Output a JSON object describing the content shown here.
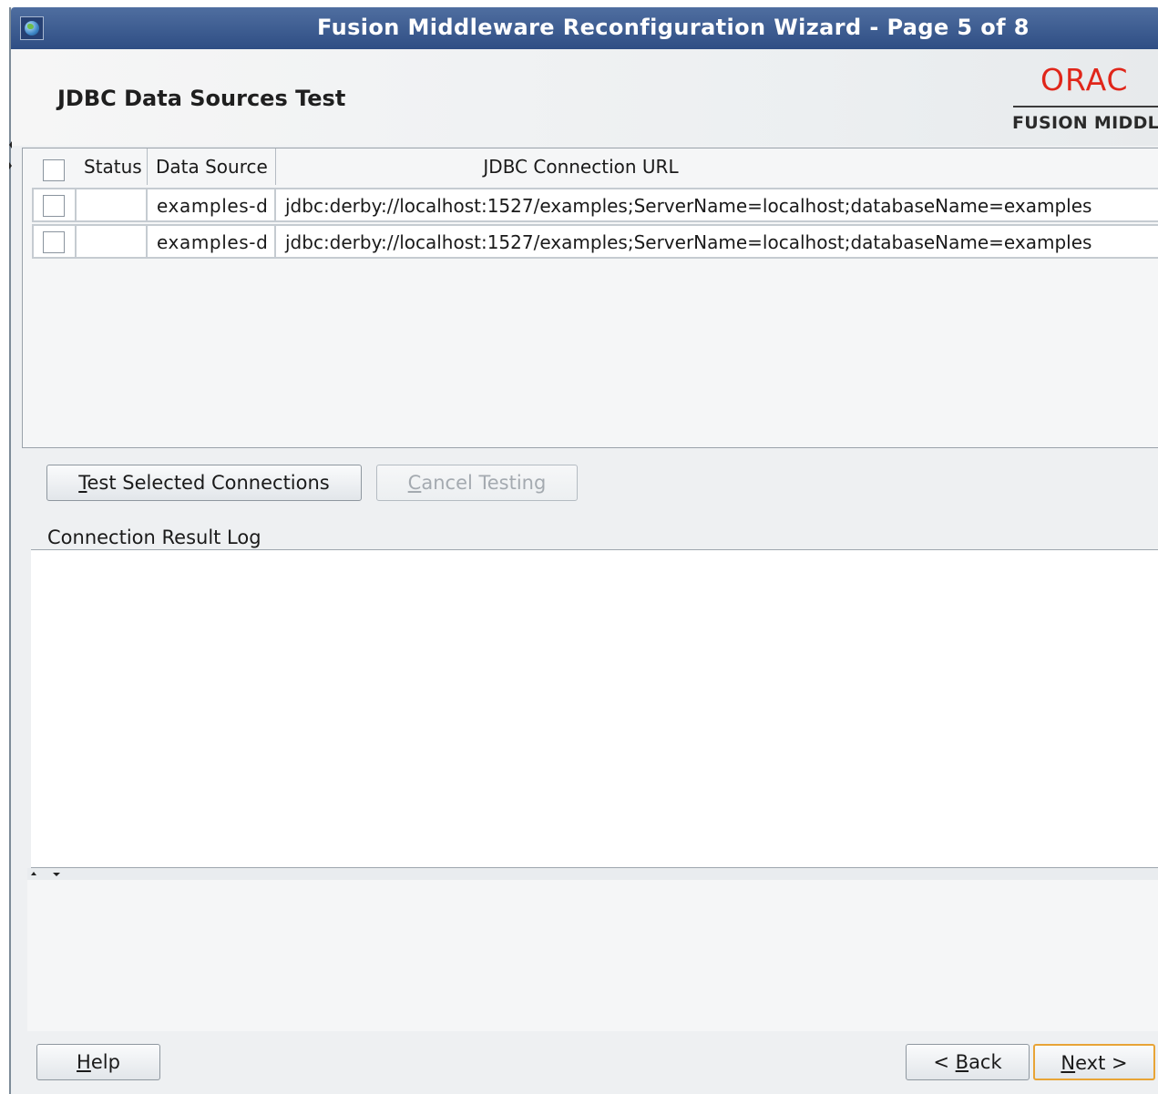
{
  "window": {
    "title": "Fusion Middleware Reconfiguration Wizard - Page 5 of 8"
  },
  "header": {
    "page_title": "JDBC Data Sources Test",
    "logo_text": "ORAC",
    "logo_subtext": "FUSION MIDDL"
  },
  "table": {
    "columns": [
      "Status",
      "Data Source",
      "JDBC Connection URL"
    ],
    "rows": [
      {
        "checked": false,
        "status": "",
        "data_source": "examples-d",
        "url": "jdbc:derby://localhost:1527/examples;ServerName=localhost;databaseName=examples"
      },
      {
        "checked": false,
        "status": "",
        "data_source": "examples-d",
        "url": "jdbc:derby://localhost:1527/examples;ServerName=localhost;databaseName=examples"
      }
    ]
  },
  "actions": {
    "test_label_mnemonic": "T",
    "test_label_rest": "est Selected Connections",
    "cancel_label_mnemonic": "C",
    "cancel_label_rest": "ancel Testing"
  },
  "log": {
    "label": "Connection Result Log",
    "content": ""
  },
  "footer": {
    "help_mnemonic": "H",
    "help_rest": "elp",
    "back_prefix": "< ",
    "back_mnemonic": "B",
    "back_rest": "ack",
    "next_mnemonic": "N",
    "next_rest": "ext >"
  },
  "colors": {
    "title_bar": "#3b5b91",
    "oracle_red": "#e0261a",
    "default_button_border": "#e8a436"
  },
  "icons": {
    "window_icon": "globe-app-icon"
  }
}
